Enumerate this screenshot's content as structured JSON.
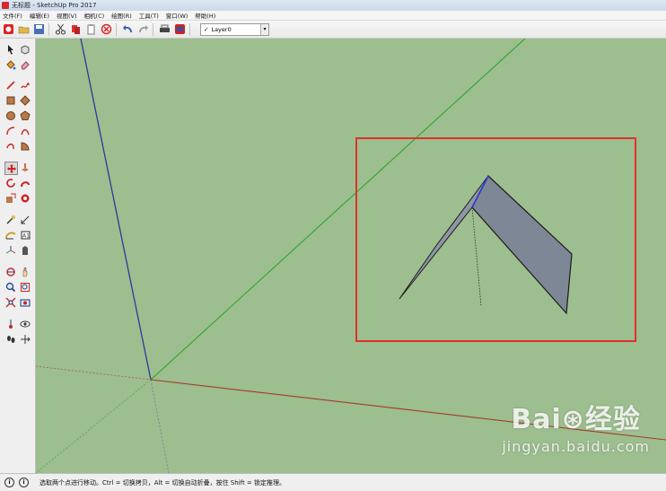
{
  "window": {
    "title": "无标题 - SketchUp Pro 2017"
  },
  "menu": [
    "文件(F)",
    "编辑(E)",
    "视图(V)",
    "相机(C)",
    "绘图(R)",
    "工具(T)",
    "窗口(W)",
    "帮助(H)"
  ],
  "layer": {
    "check": "✓",
    "name": "Layer0"
  },
  "status": {
    "text": "选取两个点进行移动。Ctrl = 切换拷贝，Alt = 切换自动折叠，按住 Shift = 锁定推理。",
    "icon1": "i",
    "icon2": "i"
  },
  "watermark": {
    "logo": "Bai⊛经验",
    "url": "jingyan.baidu.com"
  },
  "colors": {
    "viewport_bg": "#9dbe8e",
    "highlight_box": "#e0312f",
    "blue_axis": "#2a3a9a",
    "green_axis": "#1fa52a",
    "red_axis": "#a33a2a",
    "face": "#7d8796"
  }
}
